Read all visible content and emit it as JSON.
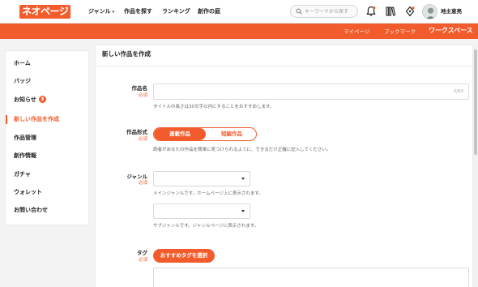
{
  "header": {
    "logo": "ネオページ",
    "nav": [
      "ジャンル",
      "作品を探す",
      "ランキング",
      "創作の庭"
    ],
    "search_placeholder": "キーワードから探す",
    "username": "地主恵亮",
    "icons": [
      "search-icon",
      "bell-icon",
      "bookshelf-icon",
      "pen-icon"
    ]
  },
  "subnav": {
    "items": [
      "マイページ",
      "ブックマーク",
      "ワークスペース"
    ],
    "active": "ワークスペース"
  },
  "sidebar": {
    "items": [
      {
        "label": "ホーム"
      },
      {
        "label": "バッジ"
      },
      {
        "label": "お知らせ",
        "badge": "3"
      },
      {
        "label": "新しい作品を作成",
        "active": true
      },
      {
        "label": "作品管理"
      },
      {
        "label": "創作情報"
      },
      {
        "label": "ガチャ"
      },
      {
        "label": "ウォレット"
      },
      {
        "label": "お問い合わせ"
      }
    ]
  },
  "colors": {
    "accent": "#f25c2c"
  },
  "form": {
    "title": "新しい作品を作成",
    "required": "必須",
    "work_name": {
      "label": "作品名",
      "value": "",
      "counter": "0/60",
      "hint": "タイトルの長さは30文字以内にすることをおすすめします。"
    },
    "work_format": {
      "label": "作品形式",
      "options": [
        "連載作品",
        "短編作品"
      ],
      "selected": "連載作品",
      "hint": "読者があなたの作品を簡単に見つけられるように、できるだけ正確に記入してください。"
    },
    "genre": {
      "label": "ジャンル",
      "main_value": "",
      "main_hint": "メインジャンルです。ホームページ上に表示されます。",
      "sub_value": "",
      "sub_hint": "サブジャンルです。ジャンルページに表示されます。"
    },
    "tags": {
      "label": "タグ",
      "button": "おすすめタグを選択"
    }
  }
}
